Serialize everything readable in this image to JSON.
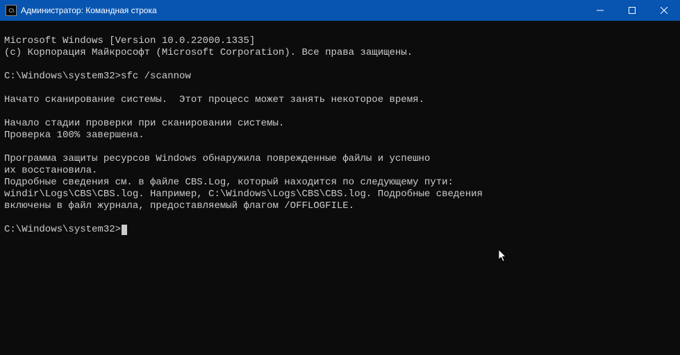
{
  "titlebar": {
    "icon_text": "C:\\",
    "title": "Администратор: Командная строка"
  },
  "terminal": {
    "version_line": "Microsoft Windows [Version 10.0.22000.1335]",
    "copyright_line": "(c) Корпорация Майкрософт (Microsoft Corporation). Все права защищены.",
    "prompt1_path": "C:\\Windows\\system32>",
    "prompt1_cmd": "sfc /scannow",
    "scan_started": "Начато сканирование системы.  Этот процесс может занять некоторое время.",
    "verify_stage": "Начало стадии проверки при сканировании системы.",
    "verify_done": "Проверка 100% завершена.",
    "result_line1": "Программа защиты ресурсов Windows обнаружила поврежденные файлы и успешно",
    "result_line2": "их восстановила.",
    "details_line1": "Подробные сведения см. в файле CBS.Log, который находится по следующему пути:",
    "details_line2": "windir\\Logs\\CBS\\CBS.log. Например, C:\\Windows\\Logs\\CBS\\CBS.log. Подробные сведения",
    "details_line3": "включены в файл журнала, предоставляемый флагом /OFFLOGFILE.",
    "prompt2_path": "C:\\Windows\\system32>"
  }
}
